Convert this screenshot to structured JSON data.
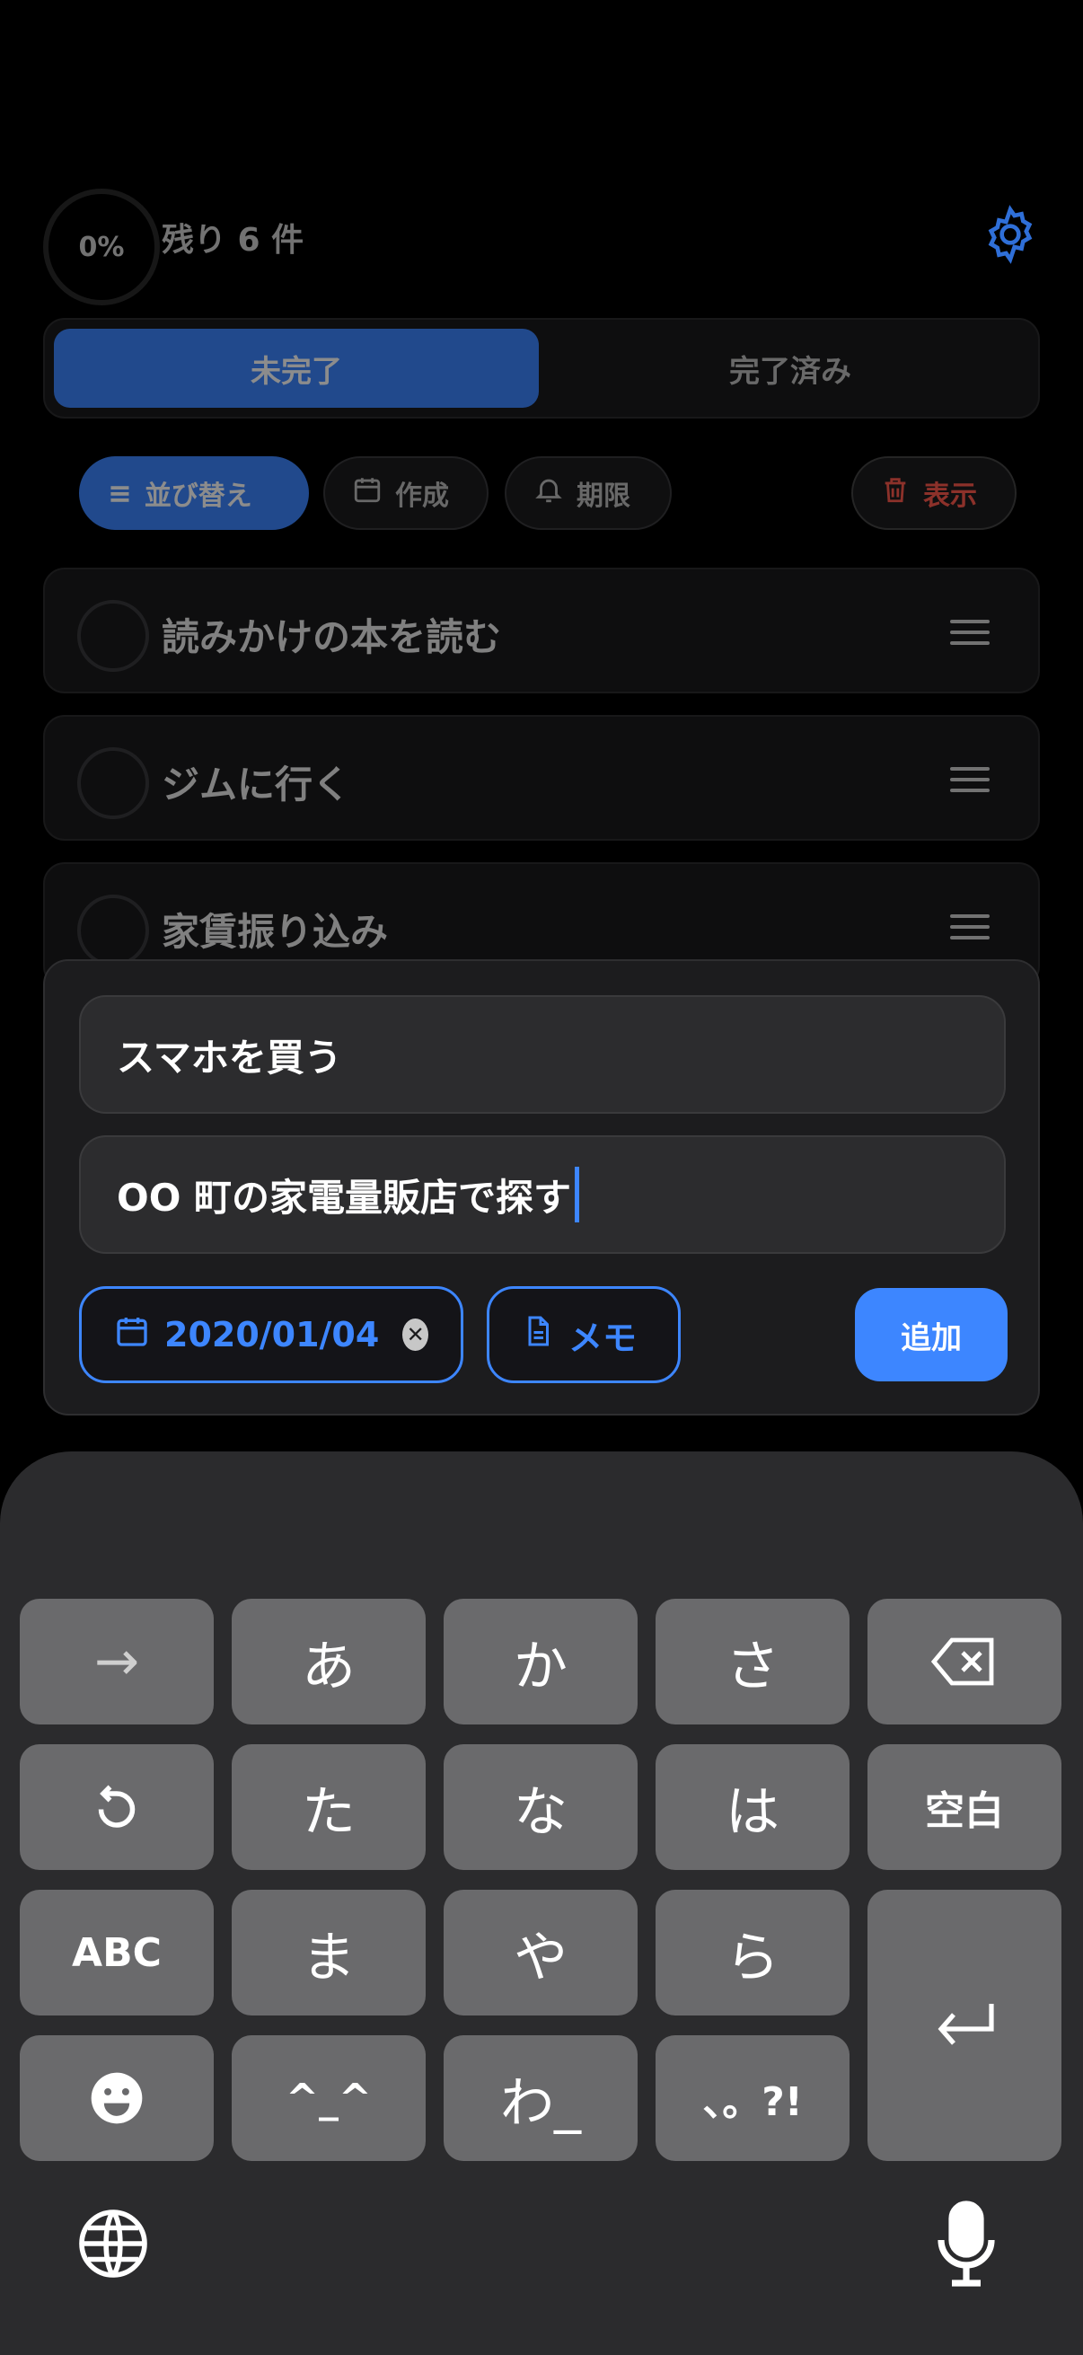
{
  "header": {
    "progress": "0%",
    "remaining": "残り 6 件"
  },
  "tabs": {
    "active": "未完了",
    "inactive": "完了済み"
  },
  "chips": {
    "sort": "並び替え",
    "created": "作成",
    "deadline": "期限",
    "show": "表示"
  },
  "tasks": [
    {
      "title": "読みかけの本を読む"
    },
    {
      "title": "ジムに行く"
    },
    {
      "title": "家賃振り込み"
    }
  ],
  "form": {
    "title_value": "スマホを買う",
    "note_value": "OO 町の家電量販店で探す",
    "date": "2020/01/04",
    "memo_label": "メモ",
    "add_label": "追加"
  },
  "keyboard": {
    "row1": [
      "→",
      "あ",
      "か",
      "さ"
    ],
    "row2": [
      "た",
      "な",
      "は",
      "空白"
    ],
    "row3": [
      "ABC",
      "ま",
      "や",
      "ら"
    ],
    "row4": [
      "^_^",
      "わ_",
      "、。?!"
    ]
  },
  "colors": {
    "accent": "#3d86ff",
    "danger": "#ff5a4e",
    "background": "#000000",
    "card": "#1c1c1e"
  }
}
